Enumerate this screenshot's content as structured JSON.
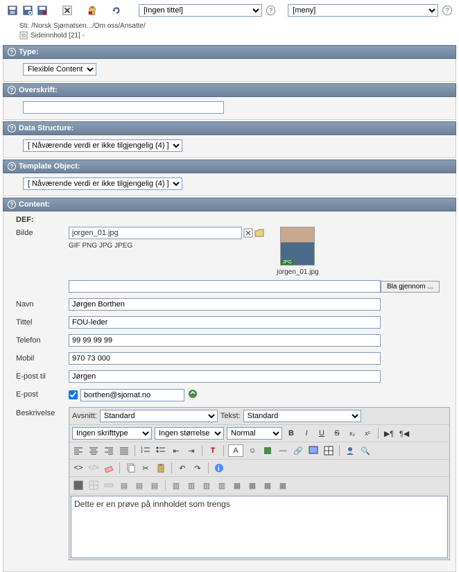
{
  "topbar": {
    "title_select": "[Ingen tittel]",
    "menu_select": "[meny]"
  },
  "path": "Sti: /Norsk Sjømatsen.../Om oss/Ansatte/",
  "subline": "Sideinnhold [21] -",
  "sections": {
    "type": {
      "title": "Type:",
      "value": "Flexible Content"
    },
    "overskrift": {
      "title": "Overskrift:",
      "value": ""
    },
    "data_structure": {
      "title": "Data Structure:",
      "value": "[ Nåværende verdi er ikke tilgjengelig (4) ]"
    },
    "template_object": {
      "title": "Template Object:",
      "value": "[ Nåværende verdi er ikke tilgjengelig (4) ]"
    },
    "content": {
      "title": "Content:"
    }
  },
  "content": {
    "def": "DEF:",
    "bilde_label": "Bilde",
    "bilde_filename": "jorgen_01.jpg",
    "formats": "GIF PNG JPG JPEG",
    "thumb_caption": "jorgen_01.jpg",
    "thumb_badge": "JPG",
    "browse_btn": "Bla gjennom ...",
    "navn_label": "Navn",
    "navn_value": "Jørgen Borthen",
    "tittel_label": "Tittel",
    "tittel_value": "FOU-leder",
    "telefon_label": "Telefon",
    "telefon_value": "99 99 99 99",
    "mobil_label": "Mobil",
    "mobil_value": "970 73 000",
    "eposttil_label": "E-post til",
    "eposttil_value": "Jørgen",
    "epost_label": "E-post",
    "epost_value": "borthen@sjomat.no",
    "beskrivelse_label": "Beskrivelse"
  },
  "rte": {
    "avsnitt_label": "Avsnitt:",
    "avsnitt_value": "Standard",
    "tekst_label": "Tekst:",
    "tekst_value": "Standard",
    "font_value": "Ingen skrifttype",
    "size_value": "Ingen størrelse",
    "weight_value": "Normal",
    "content": "Dette er en prøve på innholdet som trengs"
  }
}
